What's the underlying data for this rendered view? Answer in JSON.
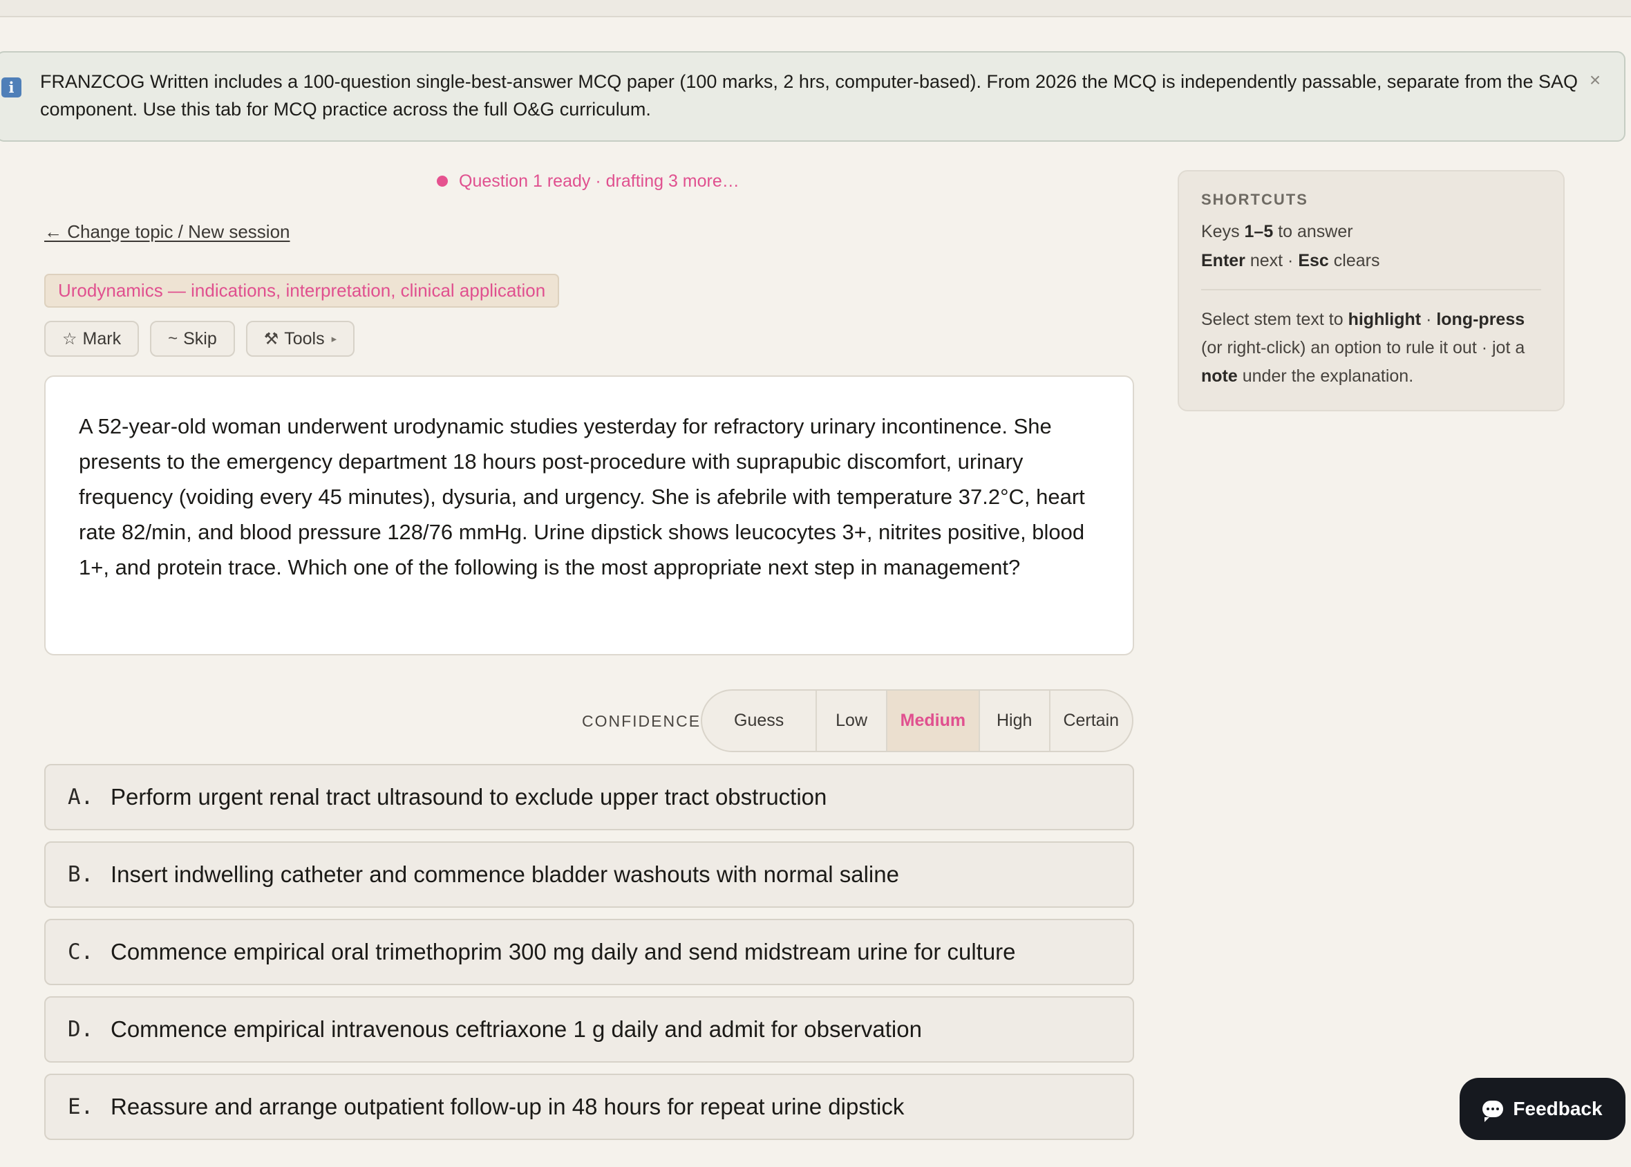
{
  "notice": {
    "icon": "info-icon",
    "text": "FRANZCOG Written includes a 100-question single-best-answer MCQ paper (100 marks, 2 hrs, computer-based). From 2026 the MCQ is independently passable, separate from the SAQ component. Use this tab for MCQ practice across the full O&G curriculum.",
    "close_icon": "close-icon",
    "close_glyph": "×"
  },
  "status": {
    "text": "Question 1 ready · drafting 3 more…",
    "color": "#e0508f"
  },
  "back_link": "← Change topic / New session",
  "topic": "Urodynamics — indications, interpretation, clinical application",
  "tools": {
    "mark_icon": "☆",
    "mark": "Mark",
    "skip_icon": "~",
    "skip": "Skip",
    "tools_icon": "⚒",
    "tools": "Tools",
    "tools_caret": "▸"
  },
  "question": {
    "stem": "A 52-year-old woman underwent urodynamic studies yesterday for refractory urinary incontinence. She presents to the emergency department 18 hours post-procedure with suprapubic discomfort, urinary frequency (voiding every 45 minutes), dysuria, and urgency. She is afebrile with temperature 37.2°C, heart rate 82/min, and blood pressure 128/76 mmHg. Urine dipstick shows leucocytes 3+, nitrites positive, blood 1+, and protein trace. Which one of the following is the most appropriate next step in management?"
  },
  "confidence": {
    "label": "CONFIDENCE",
    "levels": [
      "Guess",
      "Low",
      "Medium",
      "High",
      "Certain"
    ],
    "selected": "Medium"
  },
  "options": [
    {
      "letter": "A.",
      "text": "Perform urgent renal tract ultrasound to exclude upper tract obstruction"
    },
    {
      "letter": "B.",
      "text": "Insert indwelling catheter and commence bladder washouts with normal saline"
    },
    {
      "letter": "C.",
      "text": "Commence empirical oral trimethoprim 300 mg daily and send midstream urine for culture"
    },
    {
      "letter": "D.",
      "text": "Commence empirical intravenous ceftriaxone 1 g daily and admit for observation"
    },
    {
      "letter": "E.",
      "text": "Reassure and arrange outpatient follow-up in 48 hours for repeat urine dipstick"
    }
  ],
  "shortcuts": {
    "title": "SHORTCUTS",
    "keys_prefix": "Keys ",
    "keys_bold": "1–5",
    "keys_suffix": " to answer",
    "enter_bold": "Enter",
    "enter_text": " next · ",
    "esc_bold": "Esc",
    "esc_text": " clears",
    "tip_1": "Select stem text to ",
    "tip_highlight": "highlight",
    "tip_2": " · ",
    "tip_longpress": "long-press",
    "tip_3": " (or right-click) an option to rule it out · jot a ",
    "tip_note": "note",
    "tip_4": " under the explanation."
  },
  "feedback": {
    "label": "Feedback",
    "icon": "chat-bubble-icon"
  },
  "colors": {
    "accent": "#e0508f",
    "background": "#f5f2ec",
    "feedback_bg": "#16191f"
  }
}
